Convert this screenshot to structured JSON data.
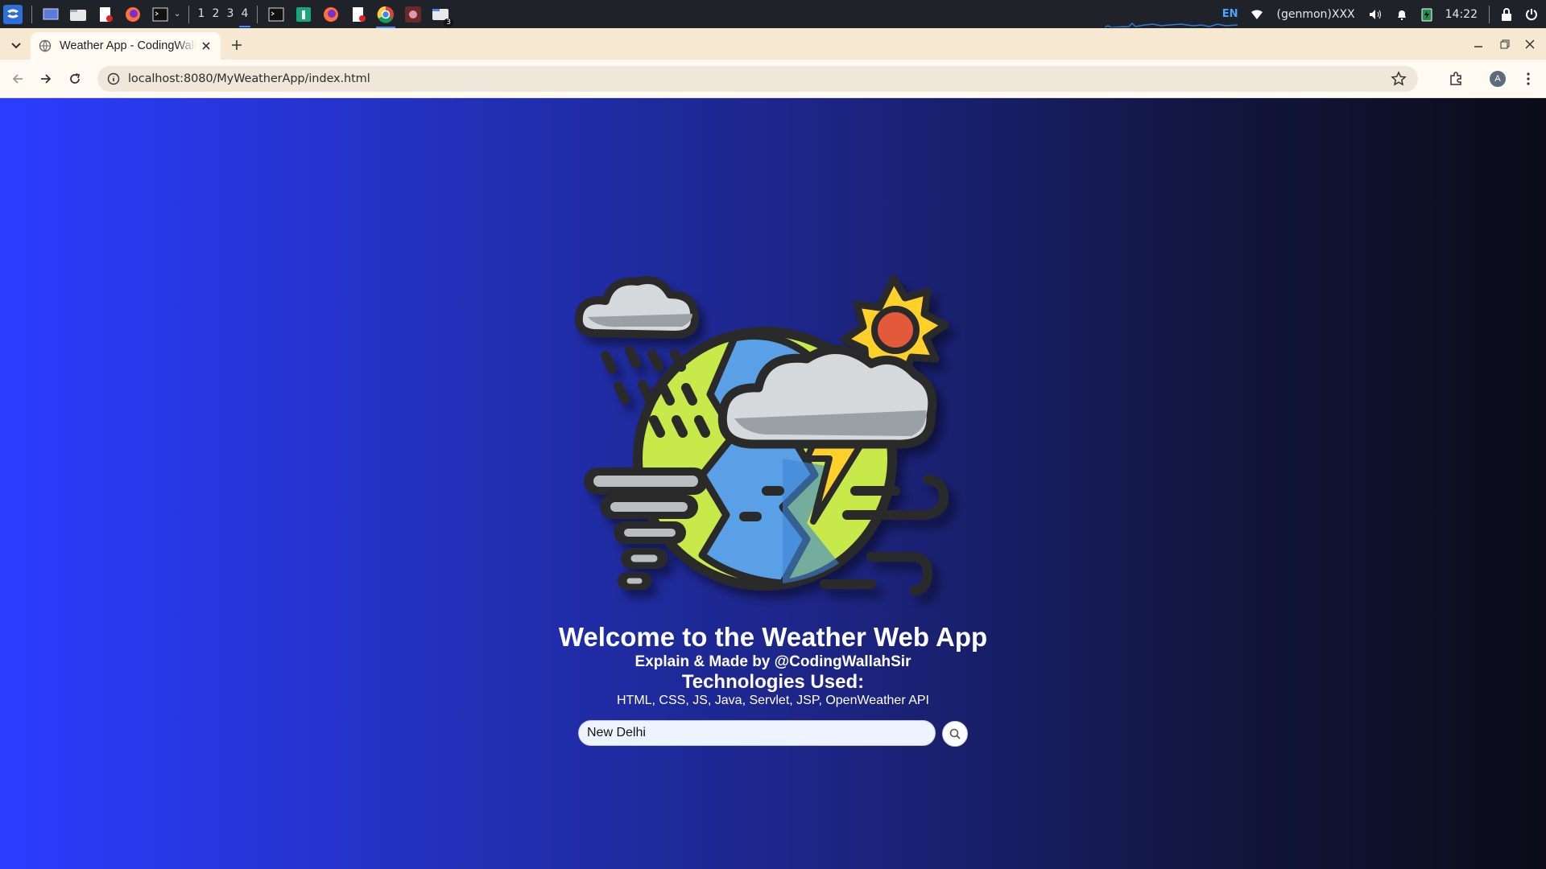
{
  "taskbar": {
    "workspaces": [
      "1",
      "2",
      "3",
      "4"
    ],
    "active_workspace": "4",
    "language": "EN",
    "network_label": "(genmon)XXX",
    "clock": "14:22",
    "launcher_icons": [
      "start-menu-icon",
      "desktop-icon",
      "file-manager-icon",
      "text-editor-icon",
      "firefox-icon",
      "terminal-icon"
    ],
    "window_icons": [
      "terminal-window-icon",
      "app-window-icon",
      "firefox-window-icon",
      "document-window-icon",
      "chrome-window-icon",
      "game-window-icon",
      "file-manager-window-icon"
    ],
    "file_manager_badge": "3"
  },
  "browser": {
    "tab_title": "Weather App - CodingWallah",
    "url": "localhost:8080/MyWeatherApp/index.html",
    "profile_initial": "A"
  },
  "page": {
    "title": "Welcome to the Weather Web App",
    "credit": "Explain & Made by @CodingWallahSir",
    "tech_heading": "Technologies Used:",
    "tech_list": "HTML, CSS, JS, Java, Servlet, JSP, OpenWeather API",
    "search_value": "New Delhi"
  },
  "colors": {
    "bg_left": "#2c3cff",
    "bg_right": "#0b0c18",
    "earth_green": "#c7e94a",
    "earth_blue": "#5aa0e6",
    "sun_yellow": "#ffcf2a",
    "outline": "#2b2b2b"
  }
}
